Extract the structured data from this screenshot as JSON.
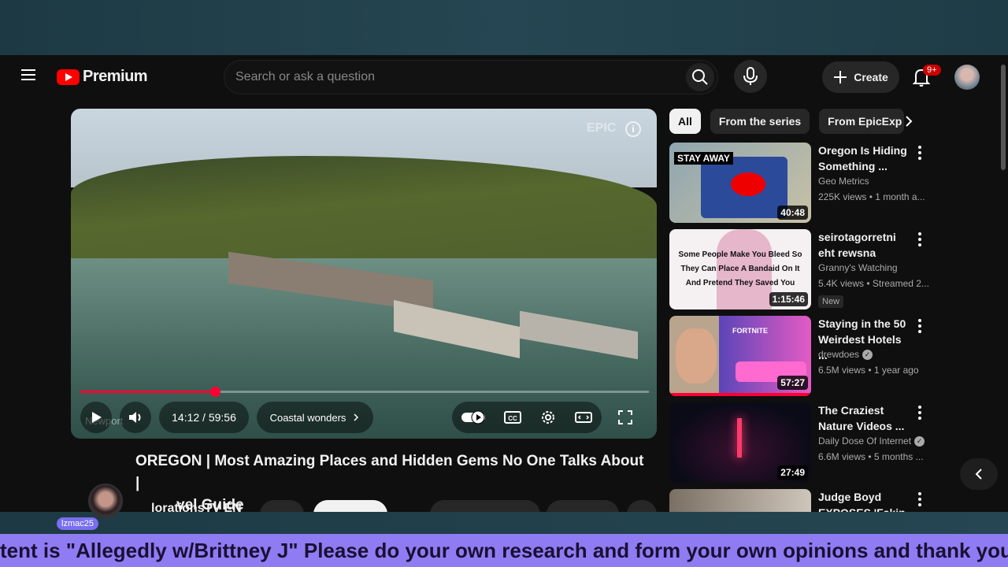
{
  "masthead": {
    "logo_text": "Premium",
    "search_placeholder": "Search or ask a question",
    "create_label": "Create",
    "notification_count": "9+"
  },
  "player": {
    "time": "14:12 / 59:56",
    "chapter": "Coastal wonders",
    "watermark": "EPIC",
    "location_label": "Newport",
    "progress_fraction": 0.237
  },
  "video": {
    "title_line1": "UNSEEN OREGON | Most Amazing Places and Hidden Gems No One Talks About |",
    "title_line2": "Travel Guide",
    "title_visible_line1": "OREGON | Most Amazing Places and Hidden Gems No One Talks About |",
    "title_visible_line2": "vel Guide",
    "channel_visible": "lorationsTV EN"
  },
  "chips": [
    {
      "label": "All",
      "active": true
    },
    {
      "label": "From the series",
      "active": false
    },
    {
      "label": "From EpicExp",
      "active": false
    }
  ],
  "recommendations": [
    {
      "title": "Oregon Is Hiding Something ...",
      "channel": "Geo Metrics",
      "meta": "225K views • 1 month a...",
      "duration": "40:48",
      "thumb_text": "STAY AWAY",
      "verified": false,
      "new": false
    },
    {
      "title": "seirotagorretni eht rewsna",
      "channel": "Granny's Watching",
      "meta": "5.4K views • Streamed 2...",
      "duration": "1:15:46",
      "thumb_text": "Some People Make You Bleed So They Can Place A Bandaid On It And Pretend They Saved You",
      "verified": false,
      "new": true,
      "new_label": "New"
    },
    {
      "title": "Staying in the 50 Weirdest Hotels ...",
      "channel": "drewdoes",
      "meta": "6.5M views • 1 year ago",
      "duration": "57:27",
      "thumb_text": "FORTNITE",
      "verified": true,
      "new": false
    },
    {
      "title": "The Craziest Nature Videos ...",
      "channel": "Daily Dose Of Internet",
      "meta": "6.6M views • 5 months ...",
      "duration": "27:49",
      "thumb_text": "",
      "verified": true,
      "new": false
    },
    {
      "title": "Judge Boyd EXPOSES 'Fakin",
      "channel": "",
      "meta": "",
      "duration": "",
      "thumb_text": "",
      "verified": false,
      "new": false
    }
  ],
  "overlay": {
    "streamer_name": "lzmac25",
    "ticker_text": "tent is \"Allegedly w/Brittney J\" Please do your own research and form your own opinions and thank you for"
  },
  "colors": {
    "accent_red": "#ff0033",
    "ticker_bg": "#8f7cf3",
    "background": "#0f0f0f"
  }
}
